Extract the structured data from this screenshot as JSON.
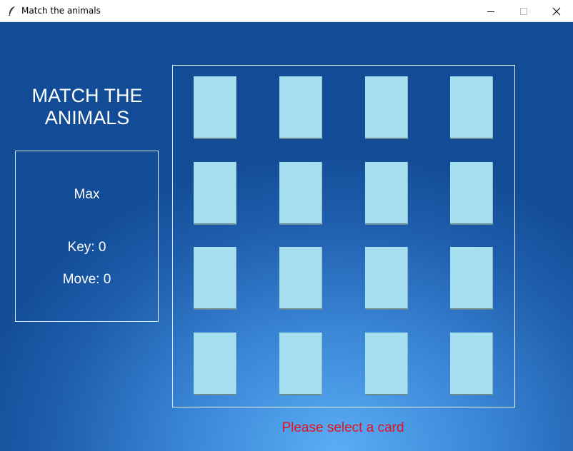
{
  "window": {
    "title": "Match the animals",
    "icon": "feather-icon",
    "controls": [
      "minimize-icon",
      "maximize-icon",
      "close-icon"
    ]
  },
  "game": {
    "title": "MATCH THE\nANIMALS",
    "player": "Max",
    "key_text": "Key: 0",
    "move_text": "Move: 0",
    "status": "Please select a card",
    "card_rows": 4,
    "card_cols": 4,
    "card_state": "face-down"
  },
  "colors": {
    "background_top": "#134c96",
    "background_glow": "#5aaef5",
    "card_back": "#a6dff0",
    "status_text": "#e8101a",
    "text": "#ffffff"
  }
}
